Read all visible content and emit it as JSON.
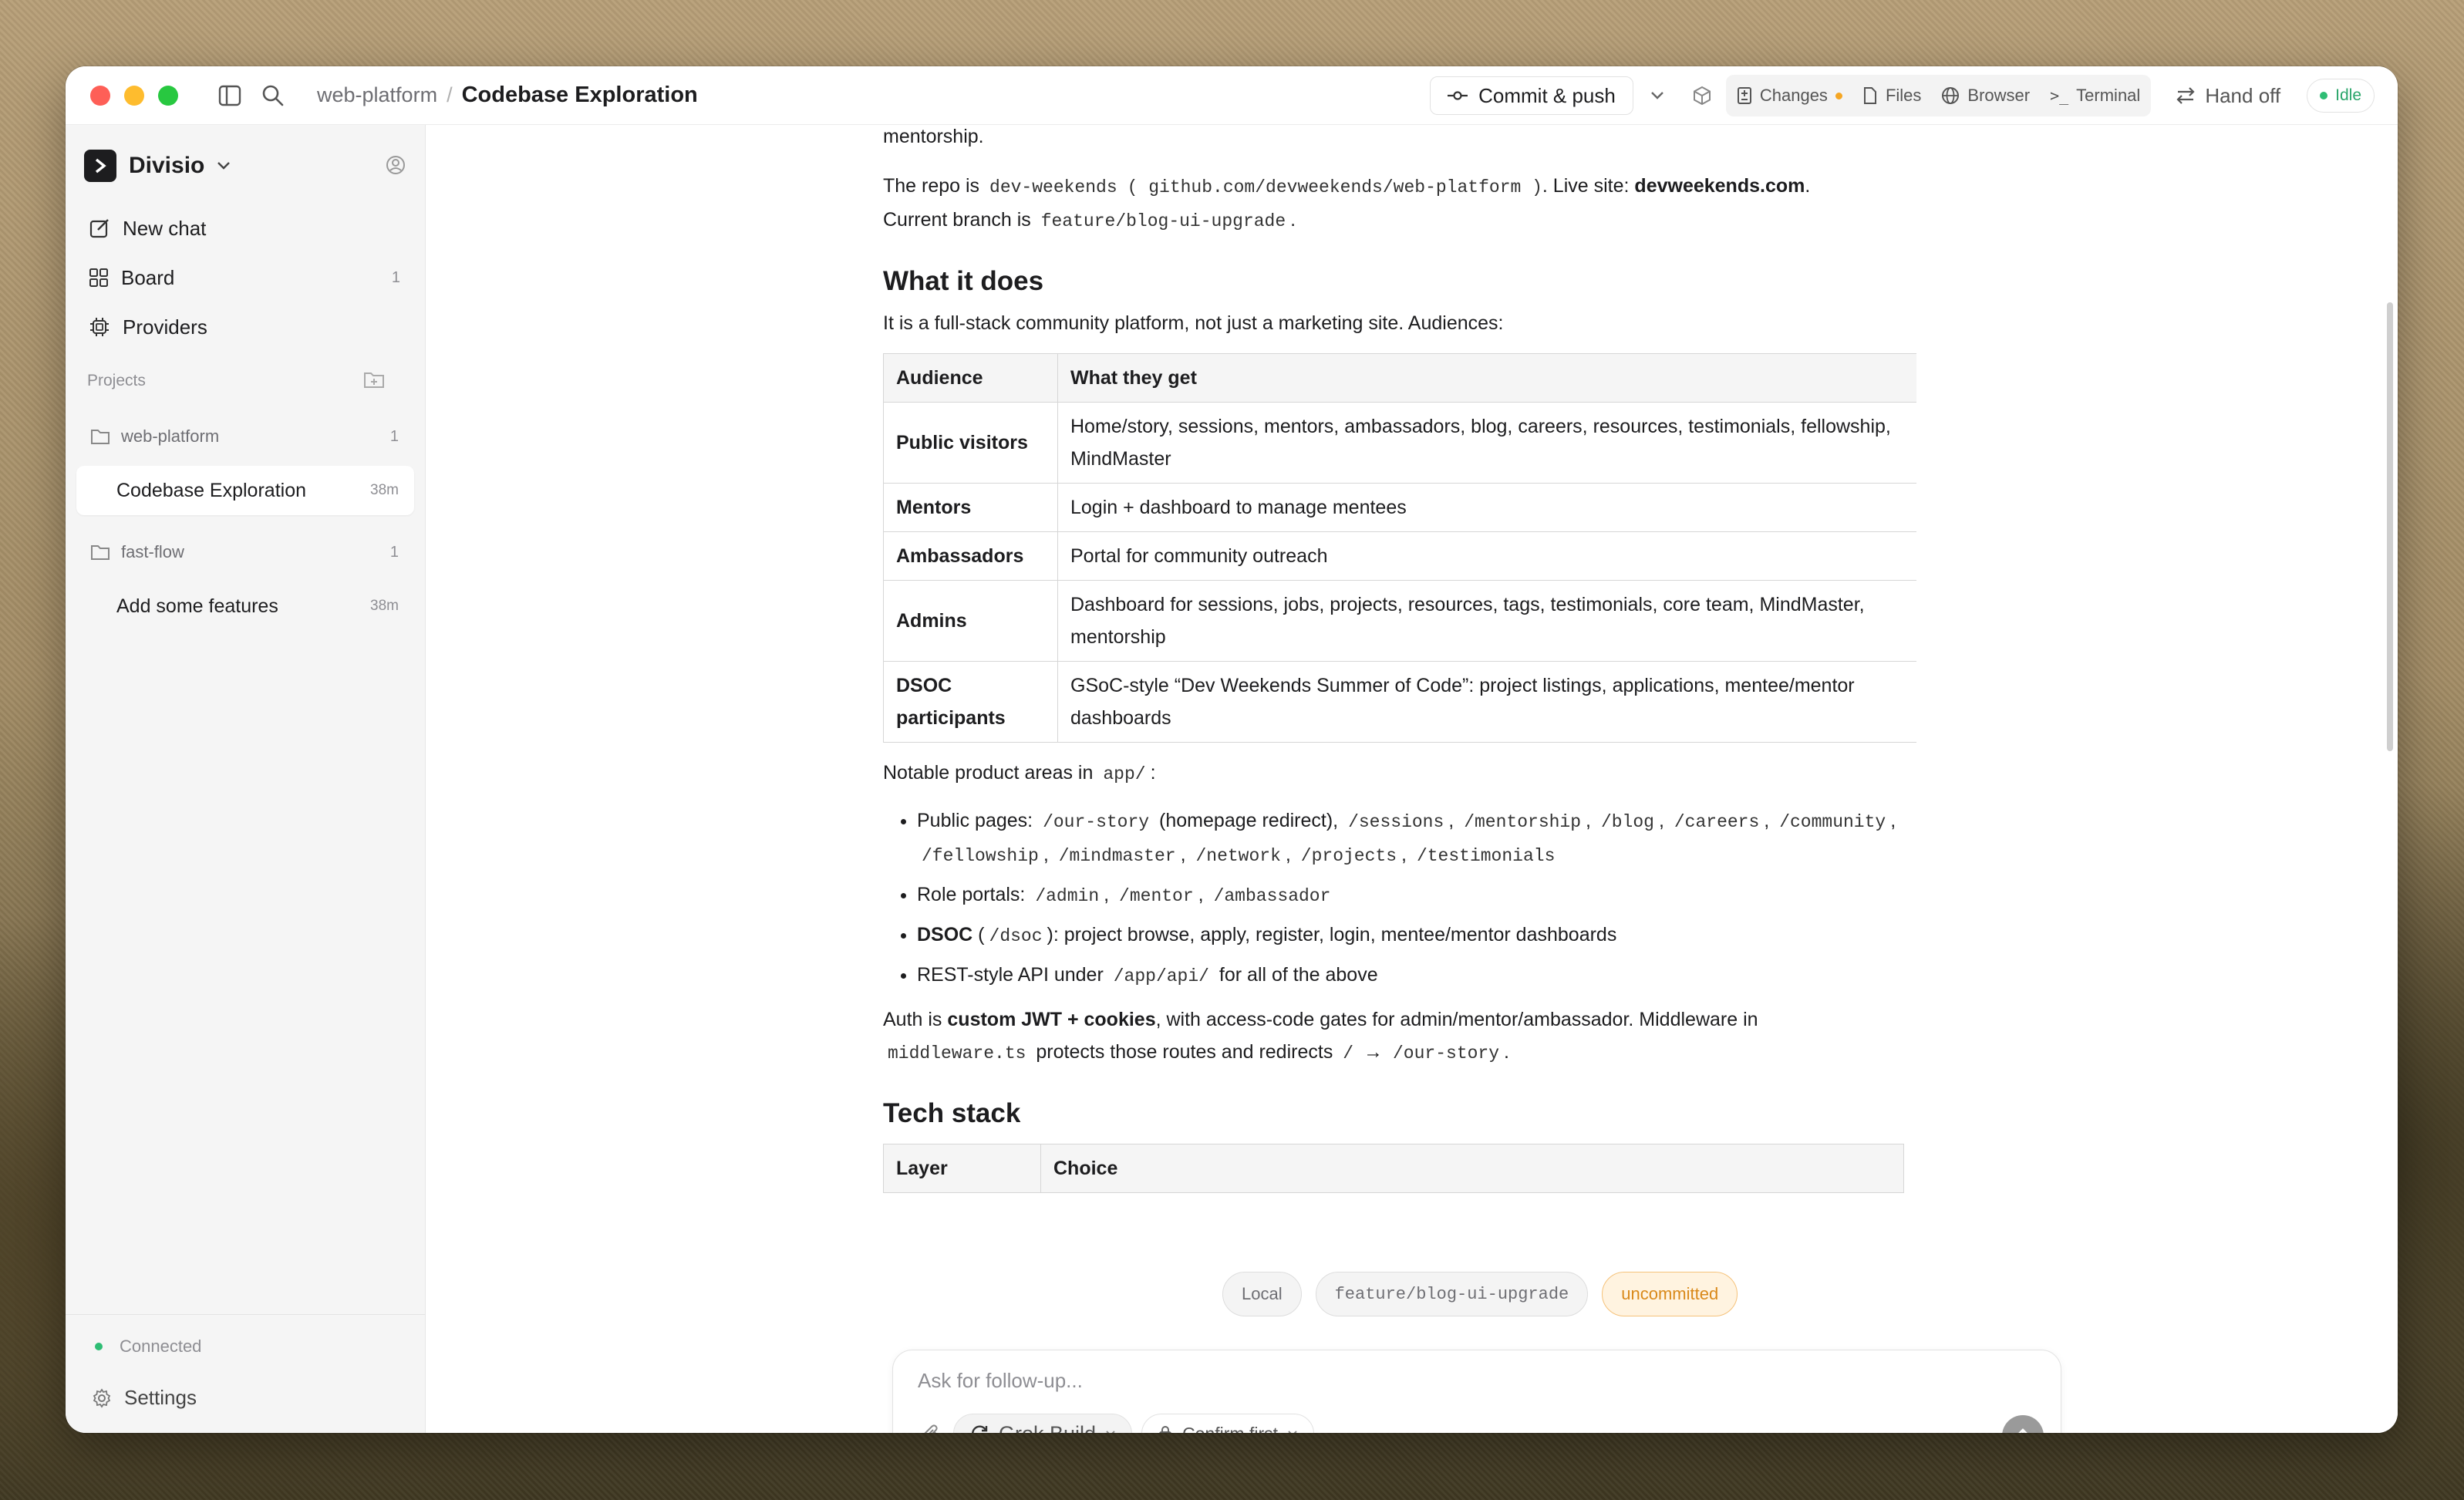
{
  "titlebar": {
    "crumb_project": "web-platform",
    "crumb_sep": "/",
    "crumb_chat": "Codebase Exploration",
    "commit_label": "Commit & push",
    "tabs": {
      "changes": "Changes",
      "files": "Files",
      "browser": "Browser",
      "terminal": "Terminal"
    },
    "handoff_label": "Hand off",
    "status": "Idle"
  },
  "sidebar": {
    "brand": "Divisio",
    "nav": [
      {
        "label": "New chat",
        "count": ""
      },
      {
        "label": "Board",
        "count": "1"
      },
      {
        "label": "Providers",
        "count": ""
      }
    ],
    "projects_label": "Projects",
    "projects": [
      {
        "name": "web-platform",
        "count": "1",
        "chats": [
          {
            "title": "Codebase Exploration",
            "time": "38m",
            "active": true
          }
        ]
      },
      {
        "name": "fast-flow",
        "count": "1",
        "chats": [
          {
            "title": "Add some features",
            "time": "38m",
            "active": false
          }
        ]
      }
    ],
    "connection": "Connected",
    "settings": "Settings"
  },
  "content": {
    "intro_tail": "mentorship.",
    "repo_prefix": "The repo is",
    "repo_name": "dev-weekends",
    "repo_url": "github.com/devweekends/web-platform",
    "live_prefix": ". Live site:",
    "live_site": "devweekends.com",
    "branch_prefix": "Current branch is",
    "branch": "feature/blog-ui-upgrade",
    "h_what": "What it does",
    "what_intro": "It is a full-stack community platform, not just a marketing site. Audiences:",
    "audience_table": {
      "headers": [
        "Audience",
        "What they get"
      ],
      "rows": [
        [
          "Public visitors",
          "Home/story, sessions, mentors, ambassadors, blog, careers, resources, testimonials, fellowship, MindMaster"
        ],
        [
          "Mentors",
          "Login + dashboard to manage mentees"
        ],
        [
          "Ambassadors",
          "Portal for community outreach"
        ],
        [
          "Admins",
          "Dashboard for sessions, jobs, projects, resources, tags, testimonials, core team, MindMaster, mentorship"
        ],
        [
          "DSOC participants",
          "GSoC-style “Dev Weekends Summer of Code”: project listings, applications, mentee/mentor dashboards"
        ]
      ]
    },
    "notable_prefix": "Notable product areas in",
    "notable_dir": "app/",
    "notable_suffix": ":",
    "bullets": {
      "public_label": "Public pages:",
      "public_routes_1": "/our-story",
      "public_note": "(homepage redirect),",
      "public_routes": [
        "/sessions",
        "/mentorship",
        "/blog",
        "/careers",
        "/community",
        "/fellowship",
        "/mindmaster",
        "/network",
        "/projects",
        "/testimonials"
      ],
      "roles_label": "Role portals:",
      "roles": [
        "/admin",
        "/mentor",
        "/ambassador"
      ],
      "dsoc_label": "DSOC",
      "dsoc_route": "/dsoc",
      "dsoc_text": "): project browse, apply, register, login, mentee/mentor dashboards",
      "api_prefix": "REST-style API under",
      "api_route": "/app/api/",
      "api_suffix": "for all of the above"
    },
    "auth_prefix": "Auth is",
    "auth_bold": "custom JWT + cookies",
    "auth_rest": ", with access-code gates for admin/mentor/ambassador. Middleware in",
    "mw_file": "middleware.ts",
    "mw_text": "protects those routes and redirects",
    "mw_from": "/",
    "mw_arrow": "→",
    "mw_to": "/our-story",
    "h_tech": "Tech stack",
    "tech_headers": [
      "Layer",
      "Choice"
    ]
  },
  "chips": [
    "Local",
    "feature/blog-ui-upgrade",
    "uncommitted"
  ],
  "composer": {
    "placeholder": "Ask for follow-up...",
    "model": "Grok Build",
    "mode": "Confirm first"
  },
  "colors": {
    "accent_green": "#2ebd74",
    "warn_orange": "#f5a623"
  }
}
